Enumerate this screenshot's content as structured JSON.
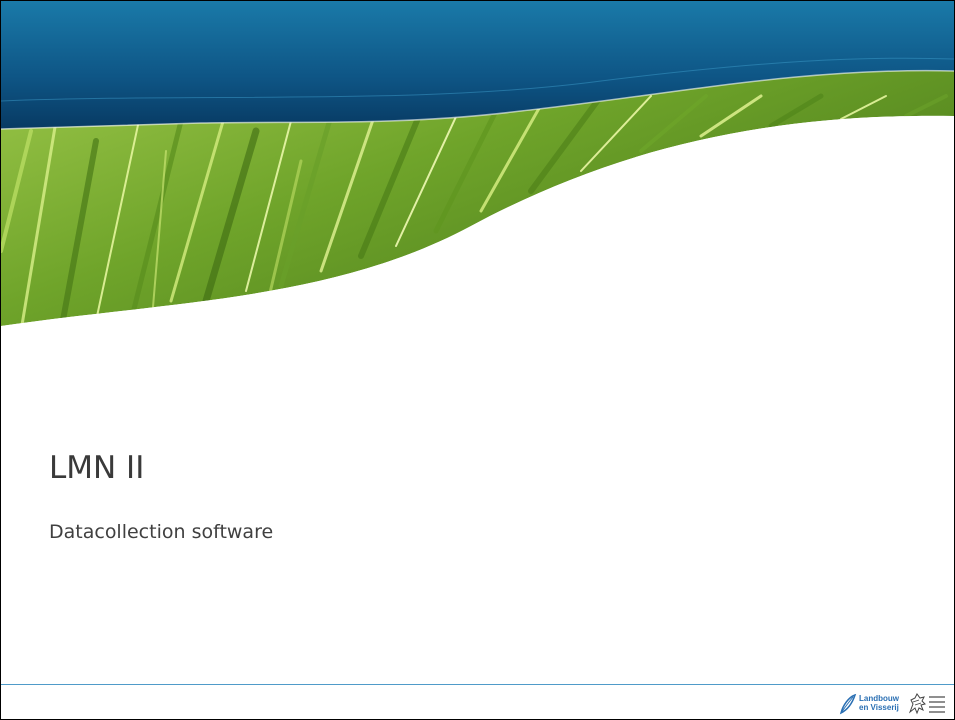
{
  "slide": {
    "title": "LMN II",
    "subtitle": "Datacollection software"
  },
  "logo": {
    "line1": "Landbouw",
    "line2": "en Visserij",
    "icon": "flemish-lion-icon",
    "leaf_icon": "leaf-icon"
  },
  "colors": {
    "banner_blue": "#0e4f7c",
    "grass_green": "#8fbf3a",
    "footer_line": "#4f9bc9",
    "logo_blue": "#2a6fb3"
  }
}
